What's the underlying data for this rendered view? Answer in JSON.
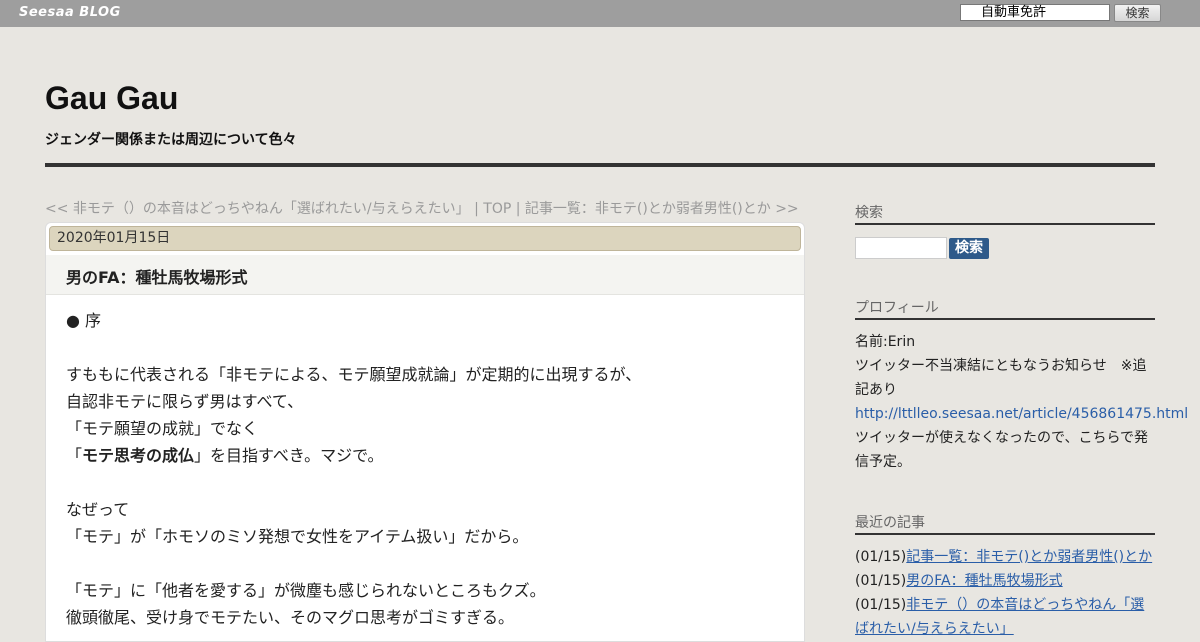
{
  "topbar": {
    "logo": "Seesaa BLOG",
    "search_value": "自動車免許",
    "search_button": "検索"
  },
  "header": {
    "title": "Gau Gau",
    "description": "ジェンダー関係または周辺について色々"
  },
  "nav": {
    "prev": "<< 非モテ（）の本音はどっちやねん「選ばれたい/与えらえたい」",
    "sep1": " | ",
    "top": "TOP",
    "sep2": " | ",
    "next": "記事一覧：非モテ()とか弱者男性()とか >>"
  },
  "article": {
    "date": "2020年01月15日",
    "title": "男のFA：種牡馬牧場形式",
    "lines": [
      "● 序",
      "",
      "すももに代表される「非モテによる、モテ願望成就論」が定期的に出現するが、",
      "自認非モテに限らず男はすべて、",
      "「モテ願望の成就」でなく",
      "",
      "",
      "なぜって",
      "「モテ」が「ホモソのミソ発想で女性をアイテム扱い」だから。",
      "",
      "「モテ」に「他者を愛する」が微塵も感じられないところもクズ。",
      "徹頭徹尾、受け身でモテたい、そのマグロ思考がゴミすぎる。"
    ],
    "line6_pre": "「",
    "line6_bold": "モテ思考の成仏",
    "line6_post": "」を目指すべき。マジで。"
  },
  "sidebar": {
    "search": {
      "heading": "検索",
      "button": "検索"
    },
    "profile": {
      "heading": "プロフィール",
      "name": "名前:Erin",
      "notice": "ツイッター不当凍結にともなうお知らせ　※追記あり",
      "link": "http://lttlleo.seesaa.net/article/456861475.html",
      "note": "ツイッターが使えなくなったので、こちらで発信予定。"
    },
    "recent": {
      "heading": "最近の記事",
      "items": [
        {
          "date": "(01/15)",
          "title": "記事一覧：非モテ()とか弱者男性()とか"
        },
        {
          "date": "(01/15)",
          "title": "男のFA：種牡馬牧場形式"
        },
        {
          "date": "(01/15)",
          "title": "非モテ（）の本音はどっちやねん「選ばれたい/与えらえたい」"
        }
      ]
    }
  },
  "colors": {
    "topbar": "#9e9e9e",
    "background": "#e8e6e1",
    "date_bar": "#dcd5be",
    "link": "#2a5ea8",
    "search_button": "#2e5a8a"
  }
}
